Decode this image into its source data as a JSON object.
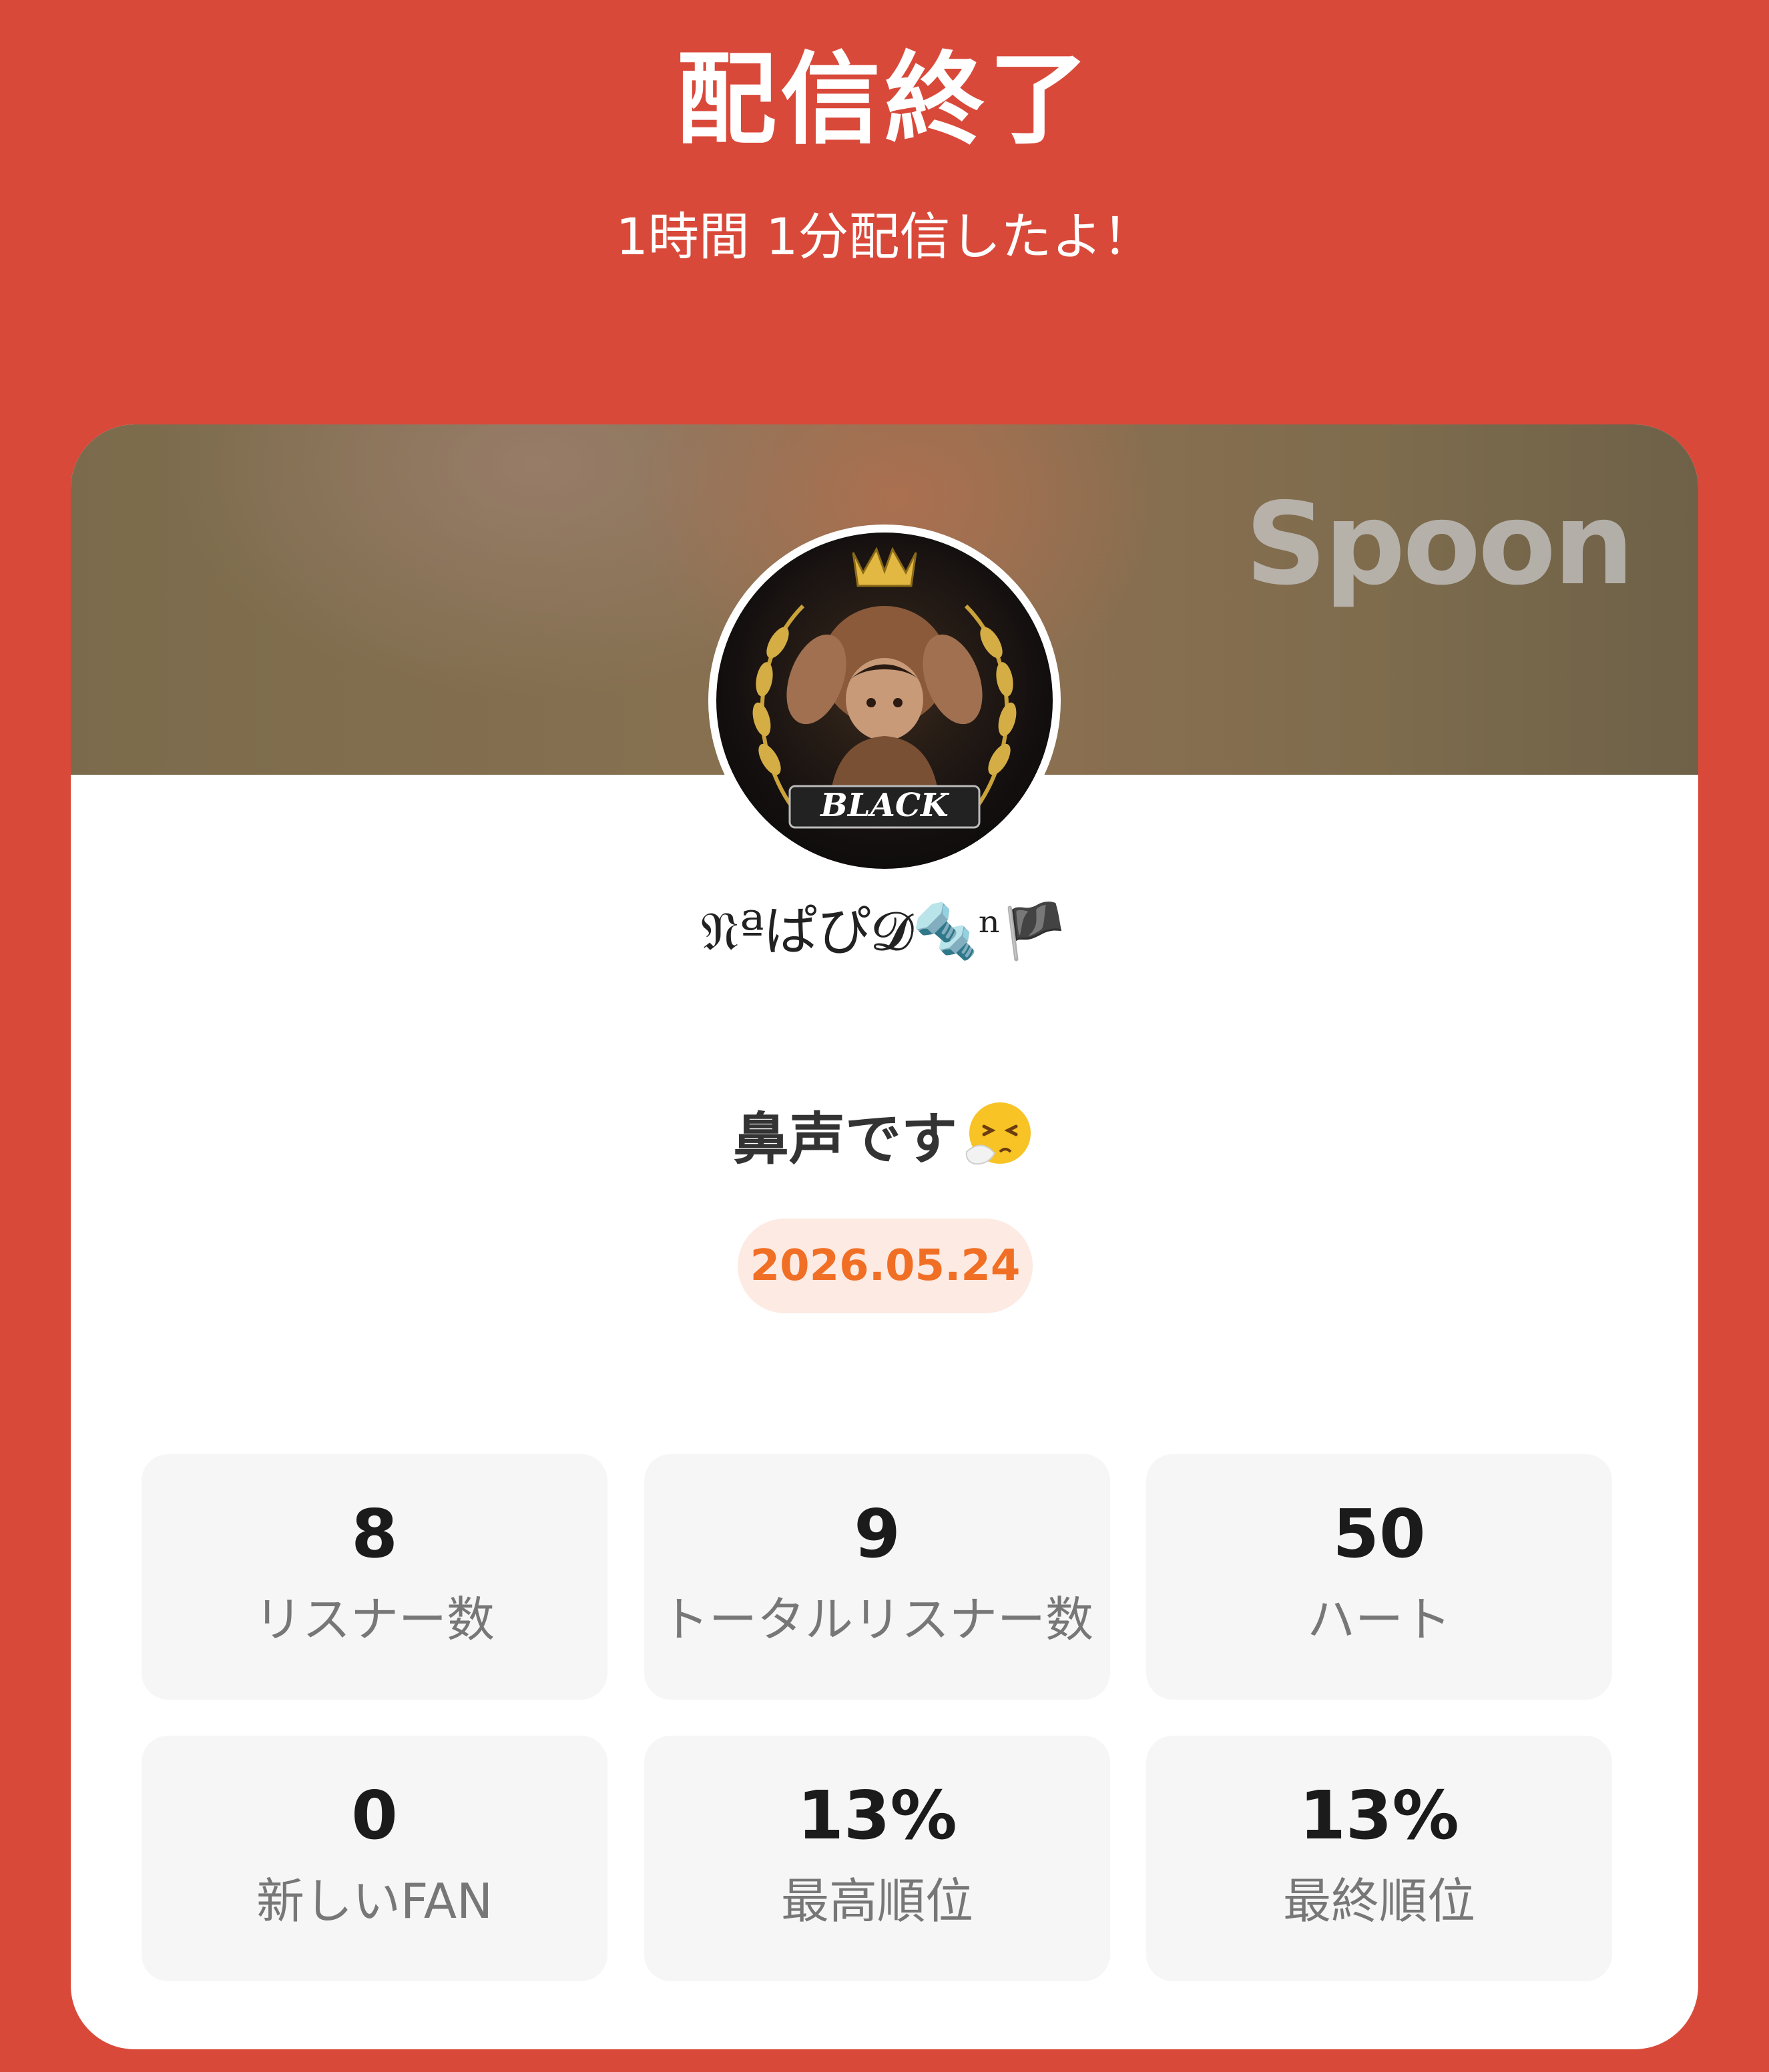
{
  "header": {
    "title": "配信終了",
    "subtitle": "1時間 1分配信したよ！"
  },
  "card": {
    "brand": "Spoon",
    "avatar_text": "BLACK",
    "username": "𝔑ªぱぴ𝓓🔩ⁿ🏴",
    "stream_title": "鼻声です",
    "stream_title_emoji": "sneezing-face",
    "date": "2026.05.24"
  },
  "stats": [
    {
      "value": "8",
      "label": "リスナー数"
    },
    {
      "value": "9",
      "label": "トータルリスナー数"
    },
    {
      "value": "50",
      "label": "ハート"
    },
    {
      "value": "0",
      "label": "新しいFAN"
    },
    {
      "value": "13%",
      "label": "最高順位"
    },
    {
      "value": "13%",
      "label": "最終順位"
    }
  ],
  "colors": {
    "background": "#d9493a",
    "date_text": "#f06f25",
    "date_pill": "#fdeae2"
  }
}
